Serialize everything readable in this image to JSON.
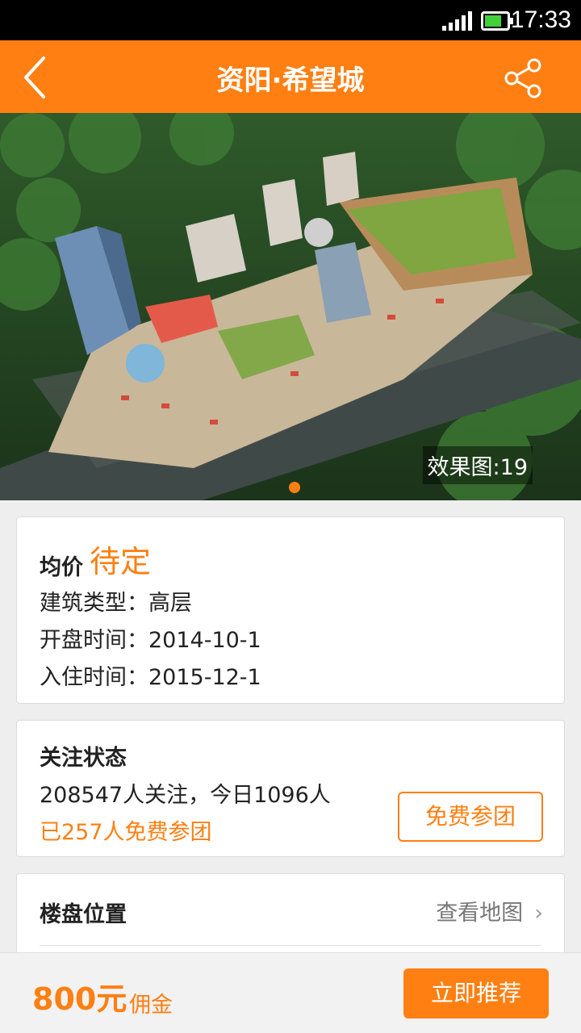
{
  "status_bar": {
    "time": "17:33"
  },
  "header": {
    "title": "资阳·希望城"
  },
  "hero": {
    "caption": "效果图:19",
    "active_dot": 1
  },
  "price_card": {
    "label": "均价",
    "value": "待定",
    "rows": [
      "建筑类型：高层",
      "开盘时间：2014-10-1",
      "入住时间：2015-12-1"
    ]
  },
  "follow_card": {
    "title": "关注状态",
    "followers_line": "208547人关注，今日1096人",
    "joined_line": "已257人免费参团",
    "join_button": "免费参团"
  },
  "location_card": {
    "title": "楼盘位置",
    "map_link": "查看地图"
  },
  "bottom_bar": {
    "commission": "800元",
    "commission_label": "佣金",
    "recommend_button": "立即推荐"
  },
  "colors": {
    "accent": "#ff7f12"
  }
}
